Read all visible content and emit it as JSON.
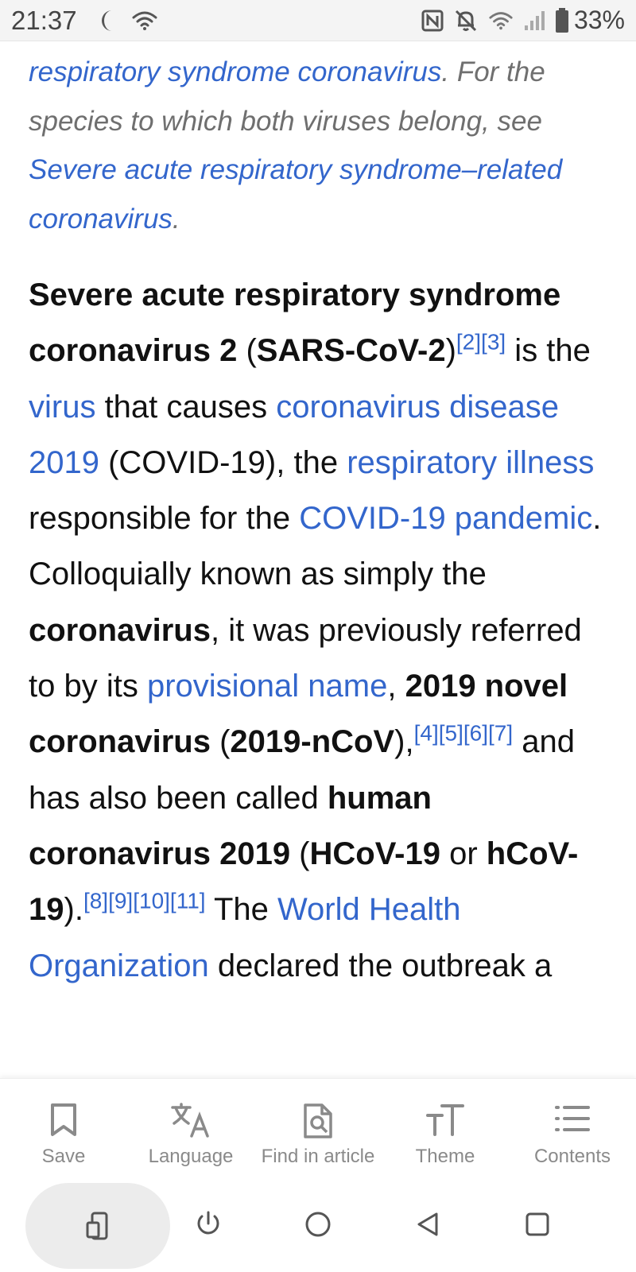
{
  "status_bar": {
    "time": "21:37",
    "battery_percent": "33%",
    "left_icons": [
      "moon-icon",
      "wifi-icon"
    ],
    "right_icons": [
      "nfc-icon",
      "bell-muted-icon",
      "wifi-icon",
      "signal-icon",
      "battery-icon"
    ]
  },
  "hatnote": {
    "link1": "respiratory syndrome coronavirus",
    "text1": ". For the species to which both viruses belong, see ",
    "link2": "Severe acute respiratory syndrome–related coronavirus",
    "text2": "."
  },
  "lead": {
    "b1": "Severe acute respiratory syndrome coronavirus 2",
    "t1": " (",
    "b2": "SARS-CoV-2",
    "t2": ")",
    "ref1": "[2]",
    "ref2": "[3]",
    "t3": " is the ",
    "l_virus": "virus",
    "t4": " that causes ",
    "l_covid": "coronavirus disease 2019",
    "t5": " (COVID-19), the ",
    "l_resp": "respiratory illness",
    "t6": " responsible for the ",
    "l_pandemic": "COVID-19 pandemic",
    "t7": ". Colloquially known as simply the ",
    "b3": "coronavirus",
    "t8": ", it was previously referred to by its ",
    "l_prov": "provisional name",
    "t9": ", ",
    "b4": "2019 novel coronavirus",
    "t10": " (",
    "b5": "2019-nCoV",
    "t11": "),",
    "ref4": "[4]",
    "ref5": "[5]",
    "ref6": "[6]",
    "ref7": "[7]",
    "t12": " and has also been called ",
    "b6": "human coronavirus 2019",
    "t13": " (",
    "b7": "HCoV-19",
    "t14": " or ",
    "b8": "hCoV-19",
    "t15": ").",
    "ref8": "[8]",
    "ref9": "[9]",
    "ref10": "[10]",
    "ref11": "[11]",
    "t16": " The ",
    "l_who": "World Health Organization",
    "t17": " declared the outbreak a"
  },
  "toolbar": {
    "save": "Save",
    "language": "Language",
    "find": "Find in article",
    "theme": "Theme",
    "contents": "Contents"
  },
  "colors": {
    "link": "#3366cc",
    "hatnote_text": "#6f6f6f",
    "toolbar_text": "#8a8a8a"
  }
}
